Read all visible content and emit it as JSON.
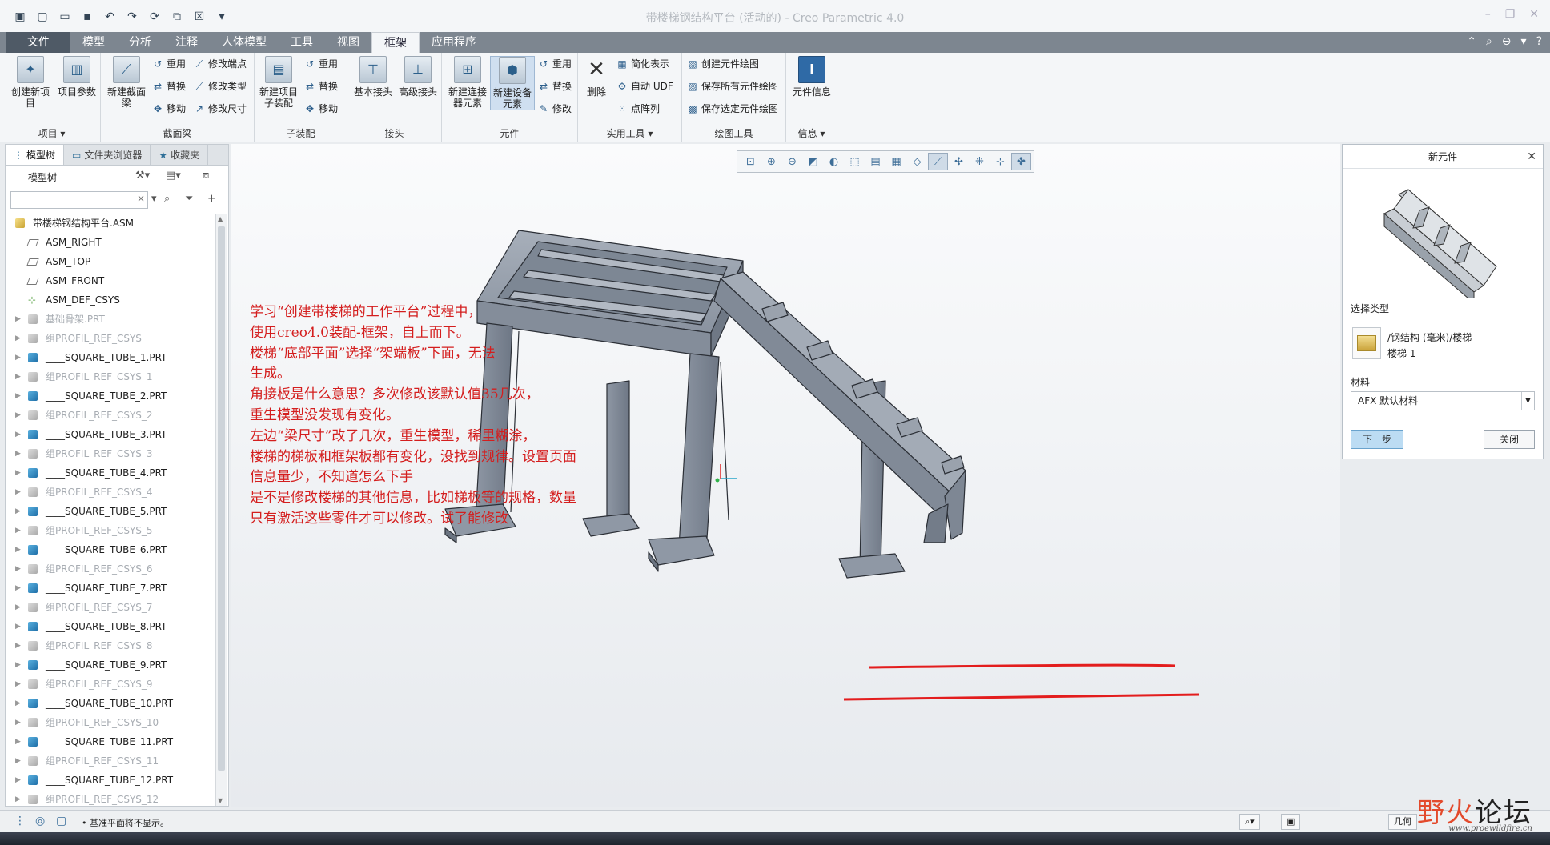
{
  "app": {
    "title": "带楼梯钢结构平台 (活动的) - Creo Parametric 4.0"
  },
  "tabs": [
    "文件",
    "模型",
    "分析",
    "注释",
    "人体模型",
    "工具",
    "视图",
    "框架",
    "应用程序"
  ],
  "ribbon": {
    "groups": {
      "item": "项目 ▾",
      "section": "截面梁",
      "subasm": "子装配",
      "joint": "接头",
      "element": "元件",
      "util": "实用工具 ▾",
      "drawing": "绘图工具",
      "info": "信息 ▾"
    },
    "buttons": {
      "create_item": "创建新项目",
      "item_params": "项目参数",
      "new_section_beam": "新建截面梁",
      "reuse": "重用",
      "replace": "替换",
      "move": "移动",
      "modify_endpoint": "修改端点",
      "modify_type": "修改类型",
      "modify_size": "修改尺寸",
      "new_item_subasm": "新建项目子装配",
      "sub_reuse": "重用",
      "sub_replace": "替换",
      "sub_move": "移动",
      "basic_joint": "基本接头",
      "advanced_joint": "高级接头",
      "new_connector": "新建连接器元素",
      "new_equipment": "新建设备元素",
      "el_reuse": "重用",
      "el_replace": "替换",
      "el_modify": "修改",
      "delete": "删除",
      "simplified_rep": "简化表示",
      "auto_udf": "自动 UDF",
      "point_pattern": "点阵列",
      "create_comp_drawing": "创建元件绘图",
      "save_all_drawings": "保存所有元件绘图",
      "save_selected_drawings": "保存选定元件绘图",
      "comp_info": "元件信息"
    }
  },
  "left_panel": {
    "tabs": [
      "模型树",
      "文件夹浏览器",
      "收藏夹"
    ],
    "title": "模型树",
    "tree": [
      {
        "label": "带楼梯钢结构平台.ASM",
        "type": "asm",
        "root": true
      },
      {
        "label": "ASM_RIGHT",
        "type": "plane"
      },
      {
        "label": "ASM_TOP",
        "type": "plane"
      },
      {
        "label": "ASM_FRONT",
        "type": "plane"
      },
      {
        "label": "ASM_DEF_CSYS",
        "type": "csys"
      },
      {
        "label": "基础骨架.PRT",
        "type": "dimpart",
        "dim": true,
        "arrow": true
      },
      {
        "label": "组PROFIL_REF_CSYS",
        "type": "dimpart",
        "dim": true,
        "arrow": true
      },
      {
        "label": "____SQUARE_TUBE_1.PRT",
        "type": "part",
        "arrow": true
      },
      {
        "label": "组PROFIL_REF_CSYS_1",
        "type": "dimpart",
        "dim": true,
        "arrow": true
      },
      {
        "label": "____SQUARE_TUBE_2.PRT",
        "type": "part",
        "arrow": true
      },
      {
        "label": "组PROFIL_REF_CSYS_2",
        "type": "dimpart",
        "dim": true,
        "arrow": true
      },
      {
        "label": "____SQUARE_TUBE_3.PRT",
        "type": "part",
        "arrow": true
      },
      {
        "label": "组PROFIL_REF_CSYS_3",
        "type": "dimpart",
        "dim": true,
        "arrow": true
      },
      {
        "label": "____SQUARE_TUBE_4.PRT",
        "type": "part",
        "arrow": true
      },
      {
        "label": "组PROFIL_REF_CSYS_4",
        "type": "dimpart",
        "dim": true,
        "arrow": true
      },
      {
        "label": "____SQUARE_TUBE_5.PRT",
        "type": "part",
        "arrow": true
      },
      {
        "label": "组PROFIL_REF_CSYS_5",
        "type": "dimpart",
        "dim": true,
        "arrow": true
      },
      {
        "label": "____SQUARE_TUBE_6.PRT",
        "type": "part",
        "arrow": true
      },
      {
        "label": "组PROFIL_REF_CSYS_6",
        "type": "dimpart",
        "dim": true,
        "arrow": true
      },
      {
        "label": "____SQUARE_TUBE_7.PRT",
        "type": "part",
        "arrow": true
      },
      {
        "label": "组PROFIL_REF_CSYS_7",
        "type": "dimpart",
        "dim": true,
        "arrow": true
      },
      {
        "label": "____SQUARE_TUBE_8.PRT",
        "type": "part",
        "arrow": true
      },
      {
        "label": "组PROFIL_REF_CSYS_8",
        "type": "dimpart",
        "dim": true,
        "arrow": true
      },
      {
        "label": "____SQUARE_TUBE_9.PRT",
        "type": "part",
        "arrow": true
      },
      {
        "label": "组PROFIL_REF_CSYS_9",
        "type": "dimpart",
        "dim": true,
        "arrow": true
      },
      {
        "label": "____SQUARE_TUBE_10.PRT",
        "type": "part",
        "arrow": true
      },
      {
        "label": "组PROFIL_REF_CSYS_10",
        "type": "dimpart",
        "dim": true,
        "arrow": true
      },
      {
        "label": "____SQUARE_TUBE_11.PRT",
        "type": "part",
        "arrow": true
      },
      {
        "label": "组PROFIL_REF_CSYS_11",
        "type": "dimpart",
        "dim": true,
        "arrow": true
      },
      {
        "label": "____SQUARE_TUBE_12.PRT",
        "type": "part",
        "arrow": true
      },
      {
        "label": "组PROFIL_REF_CSYS_12",
        "type": "dimpart",
        "dim": true,
        "arrow": true
      }
    ]
  },
  "annotation": {
    "lines": [
      "学习“创建带楼梯的工作平台”过程中，",
      "使用creo4.0装配-框架，自上而下。",
      "楼梯“底部平面”选择“架端板”下面，无法",
      "生成。",
      "角接板是什么意思？多次修改该默认值35几次，",
      "重生模型没发现有变化。",
      "左边“梁尺寸”改了几次，重生模型，稀里糊涂，",
      "楼梯的梯板和框架板都有变化，没找到规律。设置页面",
      "信息量少，不知道怎么下手",
      "是不是修改楼梯的其他信息，比如梯板等的规格，数量",
      "只有激活这些零件才可以修改。试了能修改"
    ]
  },
  "dialog": {
    "title": "新元件",
    "select_type_label": "选择类型",
    "type_path": "/钢结构 (毫米)/楼梯",
    "type_name": "楼梯 1",
    "material_label": "材料",
    "material_value": "AFX 默认材料",
    "next_button": "下一步",
    "close_button": "关闭"
  },
  "status": {
    "message": "• 基准平面将不显示。",
    "filter": "几何"
  },
  "watermark": {
    "text1": "野火",
    "text2": "论坛",
    "url": "www.proewildfire.cn"
  },
  "colors": {
    "annotation": "#d41e1e",
    "model_steel": "#8c95a3",
    "redline": "#e31d1d"
  }
}
